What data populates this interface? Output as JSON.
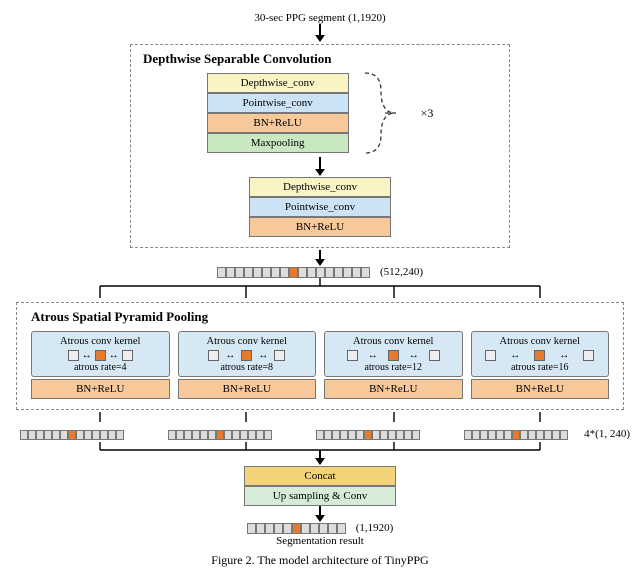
{
  "input": {
    "label": "30-sec PPG segment (1,1920)"
  },
  "dsc": {
    "title": "Depthwise Separable Convolution",
    "group1": {
      "l1": "Depthwise_conv",
      "l2": "Pointwise_conv",
      "l3": "BN+ReLU",
      "l4": "Maxpooling"
    },
    "group2": {
      "l1": "Depthwise_conv",
      "l2": "Pointwise_conv",
      "l3": "BN+ReLU"
    },
    "repeat": "×3"
  },
  "feature_map": {
    "shape": "(512,240)"
  },
  "aspp": {
    "title": "Atrous Spatial Pyramid Pooling",
    "kernel_label": "Atrous conv kernel",
    "bn": "BN+ReLU",
    "branches": [
      {
        "rate_text": "atrous rate=4"
      },
      {
        "rate_text": "atrous rate=8"
      },
      {
        "rate_text": "atrous rate=12"
      },
      {
        "rate_text": "atrous rate=16"
      }
    ]
  },
  "aspp_out": {
    "shape": "4*(1, 240)"
  },
  "post": {
    "concat": "Concat",
    "upsample": "Up sampling & Conv"
  },
  "output": {
    "shape": "(1,1920)",
    "label": "Segmentation result"
  },
  "caption": "Figure 2. The model architecture of TinyPPG"
}
